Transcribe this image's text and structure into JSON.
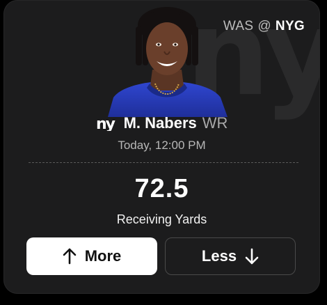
{
  "matchup": {
    "away": "WAS",
    "separator": "@",
    "home": "NYG"
  },
  "team_logo_text": "ny",
  "watermark_text": "ny",
  "player": {
    "name": "M. Nabers",
    "position": "WR"
  },
  "game_time": "Today, 12:00 PM",
  "projection": {
    "line": "72.5",
    "stat": "Receiving Yards"
  },
  "buttons": {
    "more_label": "More",
    "less_label": "Less"
  },
  "icons": {
    "more": "arrow-up-icon",
    "less": "arrow-down-icon"
  },
  "colors": {
    "card_bg": "#1c1c1d",
    "accent_primary": "#ffffff",
    "team_jersey": "#2b3fc4"
  }
}
